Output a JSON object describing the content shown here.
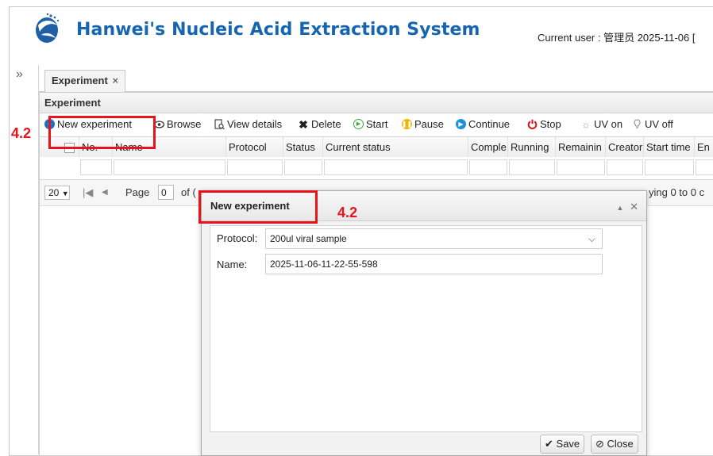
{
  "header": {
    "app_title": "Hanwei's Nucleic Acid Extraction System",
    "current_user": "Current user : 管理员  2025-11-06 ["
  },
  "sidebar": {
    "collapse_glyph": "»"
  },
  "tabs": [
    {
      "label": "Experiment",
      "close": "×"
    }
  ],
  "panel": {
    "title": "Experiment"
  },
  "toolbar": {
    "items": [
      {
        "label": "New experiment",
        "icon": "plus-circle-icon"
      },
      {
        "label": "Browse",
        "icon": "eye-icon"
      },
      {
        "label": "View details",
        "icon": "document-search-icon"
      },
      {
        "label": "Delete",
        "icon": "x-icon"
      },
      {
        "label": "Start",
        "icon": "play-icon"
      },
      {
        "label": "Pause",
        "icon": "pause-icon"
      },
      {
        "label": "Continue",
        "icon": "continue-icon"
      },
      {
        "label": "Stop",
        "icon": "power-icon"
      },
      {
        "label": "UV on",
        "icon": "bulb-on-icon"
      },
      {
        "label": "UV off",
        "icon": "bulb-off-icon"
      }
    ]
  },
  "grid": {
    "columns": [
      "No.",
      "Name",
      "Protocol",
      "Status",
      "Current status",
      "Comple",
      "Running",
      "Remainin",
      "Creator",
      "Start time",
      "En"
    ]
  },
  "pager": {
    "page_size": "20",
    "page_label": "Page",
    "page_value": "0",
    "of_label": "of (",
    "displaying": "ying 0 to 0 c"
  },
  "dialog": {
    "title": "New experiment",
    "protocol_label": "Protocol:",
    "protocol_value": "200ul viral sample",
    "name_label": "Name:",
    "name_value": "2025-11-06-11-22-55-598",
    "save_label": "Save",
    "close_label": "Close"
  },
  "annotations": {
    "toolbar_marker": "4.2",
    "dialog_marker": "4.2"
  },
  "colors": {
    "brand": "#1565b0",
    "annotation": "#e8141b",
    "start": "#3aa83a",
    "pause": "#f0b400",
    "continue": "#1e90e0",
    "stop": "#d9161c"
  }
}
